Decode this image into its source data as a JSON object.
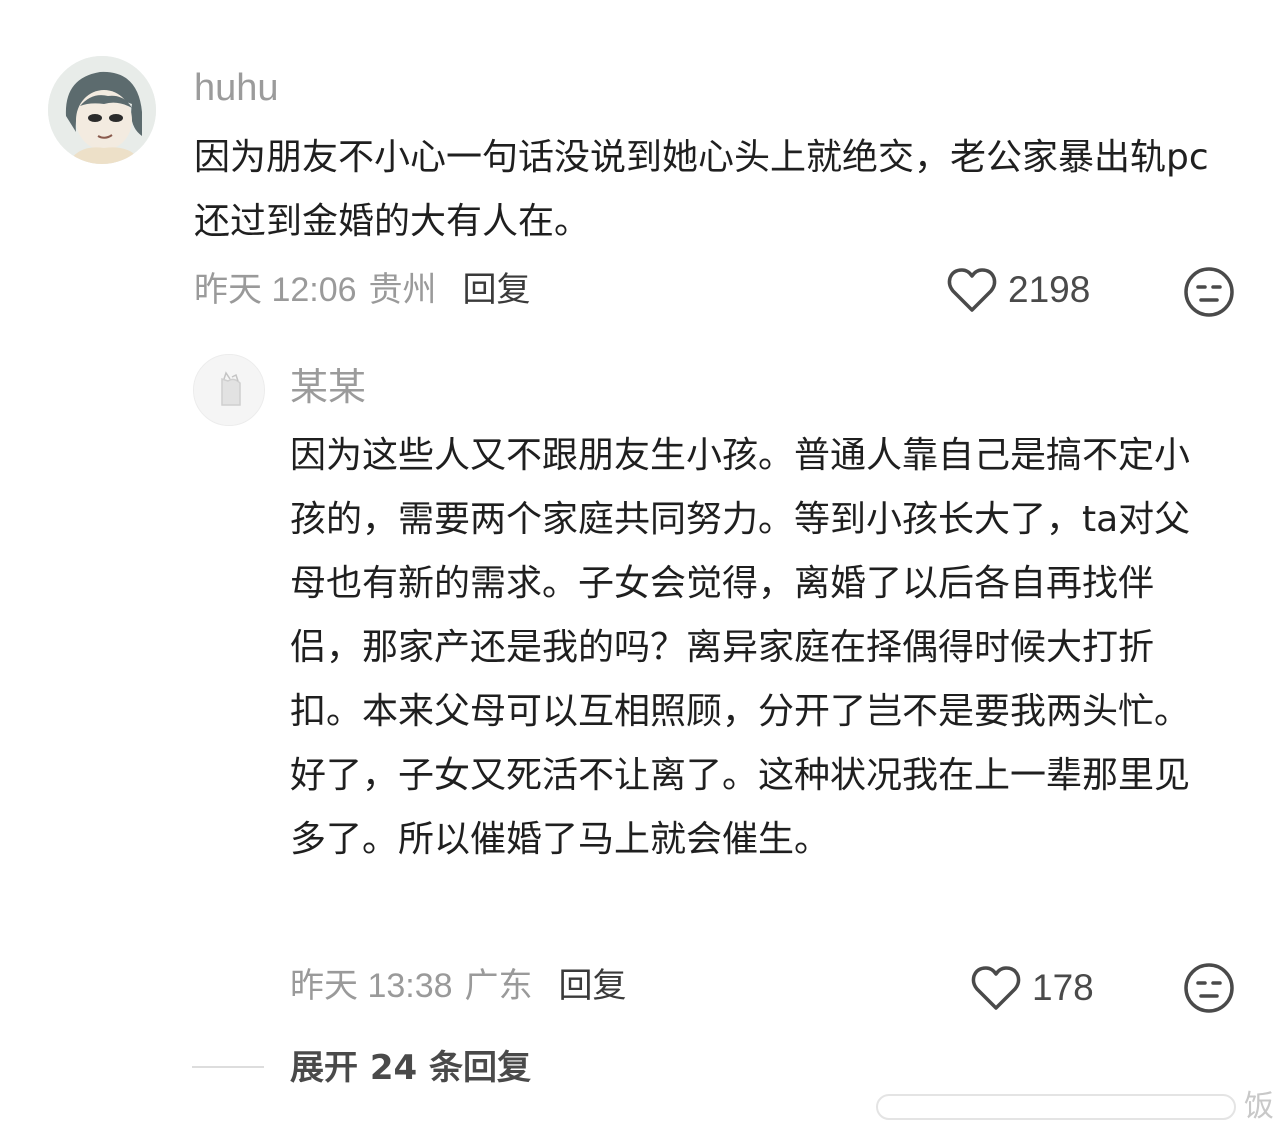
{
  "comments": [
    {
      "username": "huhu",
      "text": "因为朋友不小心一句话没说到她心头上就绝交，老公家暴出轨pc还过到金婚的大有人在。",
      "time": "昨天 12:06",
      "location": "贵州",
      "reply_label": "回复",
      "likes": "2198"
    },
    {
      "username": "某某",
      "text": "因为这些人又不跟朋友生小孩。普通人靠自己是搞不定小孩的，需要两个家庭共同努力。等到小孩长大了，ta对父母也有新的需求。子女会觉得，离婚了以后各自再找伴侣，那家产还是我的吗？离异家庭在择偶得时候大打折扣。本来父母可以互相照顾，分开了岂不是要我两头忙。好了，子女又死活不让离了。这种状况我在上一辈那里见多了。所以催婚了马上就会催生。",
      "time": "昨天 13:38",
      "location": "广东",
      "reply_label": "回复",
      "likes": "178"
    }
  ],
  "expand_replies": "展开 24 条回复",
  "watermark": "饭",
  "icons": {
    "like": "heart-outline-icon",
    "emoji": "neutral-face-icon"
  },
  "colors": {
    "text": "#1f1f1f",
    "meta": "#9a9a9a",
    "username": "#9b9b9b"
  }
}
